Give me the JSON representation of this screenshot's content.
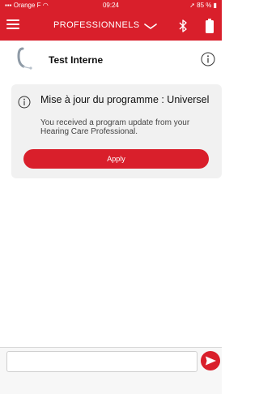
{
  "status_bar": {
    "carrier": "Orange F",
    "time": "09:24",
    "battery": "85 %"
  },
  "nav": {
    "title": "PROFESSIONNELS",
    "icons": [
      "menu-icon",
      "chevron-down-icon",
      "bluetooth-icon",
      "battery-icon"
    ]
  },
  "device": {
    "name": "Test Interne",
    "icons": [
      "hearing-aid-icon",
      "info-icon"
    ]
  },
  "update_card": {
    "title": "Mise à jour du programme : Universel",
    "message": "You received a program update from your Hearing Care Professional.",
    "apply_label": "Apply",
    "icons": [
      "info-icon"
    ]
  },
  "composer": {
    "input_value": "",
    "icons": [
      "send-icon"
    ]
  },
  "colors": {
    "brand_red": "#d91f2b",
    "card_bg": "#f1f1f1"
  }
}
